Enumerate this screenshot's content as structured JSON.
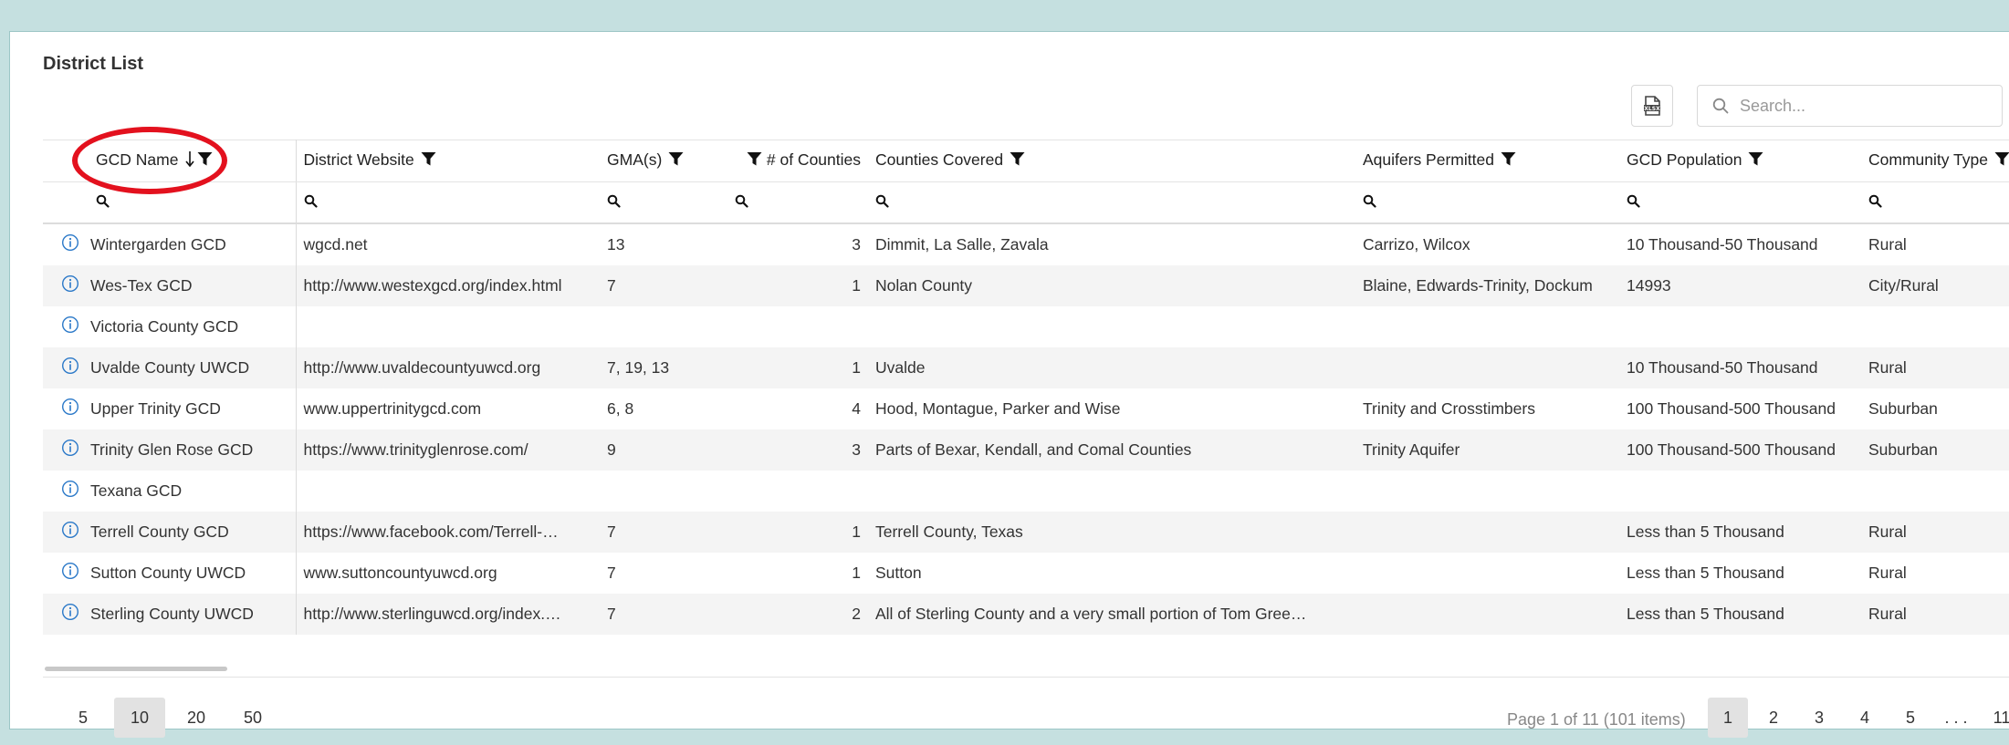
{
  "title": "District List",
  "search": {
    "placeholder": "Search..."
  },
  "columns": [
    {
      "label": "GCD Name"
    },
    {
      "label": "District Website"
    },
    {
      "label": "GMA(s)"
    },
    {
      "label": "# of Counties"
    },
    {
      "label": "Counties Covered"
    },
    {
      "label": "Aquifers Permitted"
    },
    {
      "label": "GCD Population"
    },
    {
      "label": "Community Type"
    }
  ],
  "rows": [
    [
      "Wintergarden GCD",
      "wgcd.net",
      "13",
      "3",
      "Dimmit, La Salle, Zavala",
      "Carrizo, Wilcox",
      "10 Thousand-50 Thousand",
      "Rural"
    ],
    [
      "Wes-Tex GCD",
      "http://www.westexgcd.org/index.html",
      "7",
      "1",
      "Nolan County",
      "Blaine, Edwards-Trinity, Dockum",
      "14993",
      "City/Rural"
    ],
    [
      "Victoria County GCD",
      "",
      "",
      "",
      "",
      "",
      "",
      ""
    ],
    [
      "Uvalde County UWCD",
      "http://www.uvaldecountyuwcd.org",
      "7, 19, 13",
      "1",
      "Uvalde",
      "",
      "10 Thousand-50 Thousand",
      "Rural"
    ],
    [
      "Upper Trinity GCD",
      "www.uppertrinitygcd.com",
      "6, 8",
      "4",
      "Hood, Montague, Parker and Wise",
      "Trinity and Crosstimbers",
      "100 Thousand-500 Thousand",
      "Suburban"
    ],
    [
      "Trinity Glen Rose GCD",
      "https://www.trinityglenrose.com/",
      "9",
      "3",
      "Parts of Bexar, Kendall, and Comal Counties",
      "Trinity Aquifer",
      "100 Thousand-500 Thousand",
      "Suburban"
    ],
    [
      "Texana GCD",
      "",
      "",
      "",
      "",
      "",
      "",
      ""
    ],
    [
      "Terrell County GCD",
      "https://www.facebook.com/Terrell-…",
      "7",
      "1",
      "Terrell County, Texas",
      "",
      "Less than 5 Thousand",
      "Rural"
    ],
    [
      "Sutton County UWCD",
      "www.suttoncountyuwcd.org",
      "7",
      "1",
      "Sutton",
      "",
      "Less than 5 Thousand",
      "Rural"
    ],
    [
      "Sterling County UWCD",
      "http://www.sterlinguwcd.org/index.…",
      "7",
      "2",
      "All of Sterling County and a very small portion of Tom Gree…",
      "",
      "Less than 5 Thousand",
      "Rural"
    ]
  ],
  "pager": {
    "sizes": [
      "5",
      "10",
      "20",
      "50"
    ],
    "info": "Page 1 of 11 (101 items)",
    "pages": [
      "1",
      "2",
      "3",
      "4",
      "5",
      ". . .",
      "11"
    ]
  }
}
